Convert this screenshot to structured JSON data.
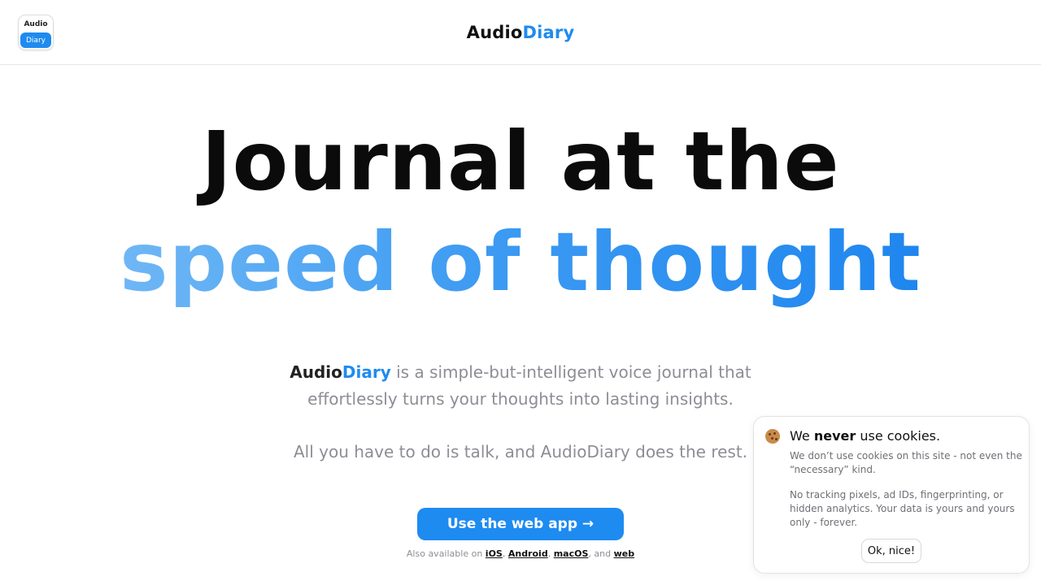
{
  "header": {
    "app_icon": {
      "top": "Audio",
      "bottom": "Diary"
    },
    "brand_a": "Audio",
    "brand_b": "Diary"
  },
  "hero": {
    "line1": "Journal at the",
    "line2": "speed of thought"
  },
  "description": {
    "brand_a": "Audio",
    "brand_b": "Diary",
    "text": " is a simple-but-intelligent voice journal that effortlessly turns your thoughts into lasting insights.",
    "line2": "All you have to do is talk, and AudioDiary does the rest."
  },
  "cta": {
    "label": "Use the web app →"
  },
  "platforms": {
    "prefix": "Also available on",
    "ios": "iOS",
    "android": "Android",
    "macos": "macOS",
    "and": "and",
    "web": "web"
  },
  "cookie": {
    "title_pre": "We",
    "title_bold": "never",
    "title_post": "use cookies.",
    "p1": "We don’t use cookies on this site - not even the “necessary” kind.",
    "p2": "No tracking pixels, ad IDs, fingerprinting, or hidden analytics. Your data is yours and yours only - forever.",
    "ok_label": "Ok, nice!"
  },
  "colors": {
    "accent": "#1e8bf0",
    "muted_text": "#8d8d95"
  },
  "icons": {
    "cookie": "cookie-icon",
    "app": "app-logo-icon"
  }
}
